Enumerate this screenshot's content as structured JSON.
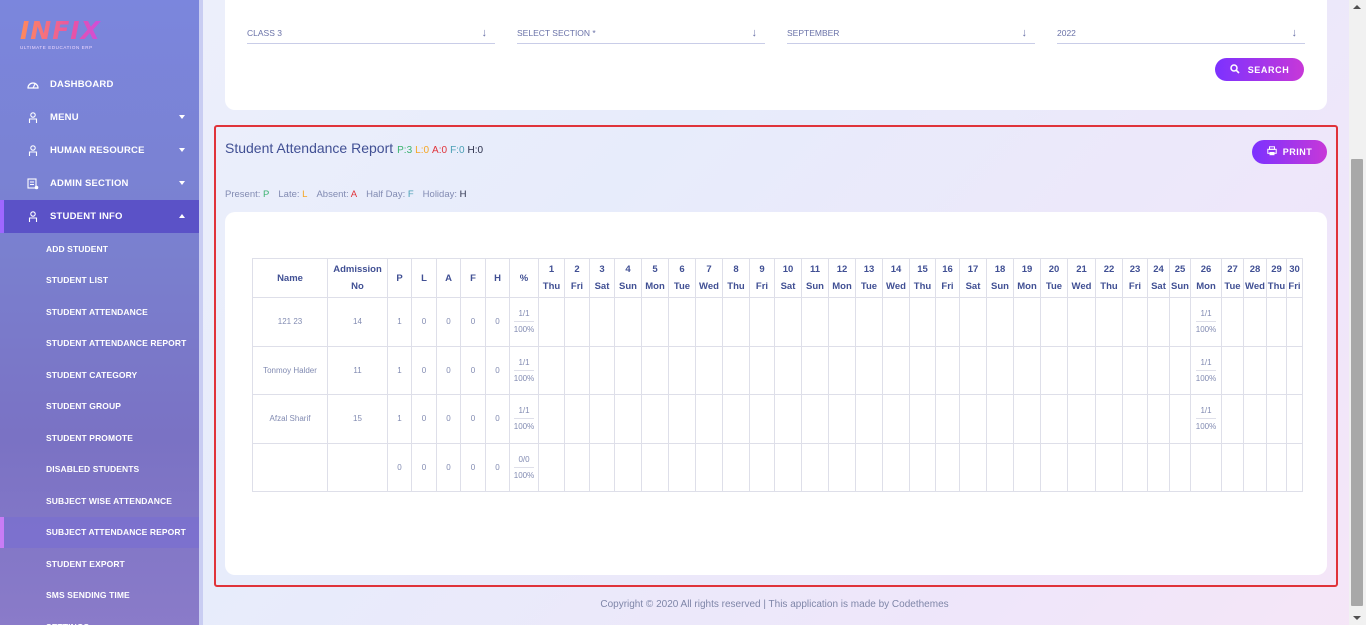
{
  "brand": {
    "logo": "INFIX",
    "tagline": "ULTIMATE EDUCATION ERP"
  },
  "sidebar": {
    "items": [
      {
        "label": "DASHBOARD",
        "icon": "dashboard-icon",
        "has_caret": false
      },
      {
        "label": "MENU",
        "icon": "menu-icon",
        "has_caret": true
      },
      {
        "label": "HUMAN RESOURCE",
        "icon": "hr-icon",
        "has_caret": true
      },
      {
        "label": "ADMIN SECTION",
        "icon": "admin-icon",
        "has_caret": true
      },
      {
        "label": "STUDENT INFO",
        "icon": "student-icon",
        "has_caret": true,
        "active": true
      }
    ],
    "sub_items": [
      "ADD STUDENT",
      "STUDENT LIST",
      "STUDENT ATTENDANCE",
      "STUDENT ATTENDANCE REPORT",
      "STUDENT CATEGORY",
      "STUDENT GROUP",
      "STUDENT PROMOTE",
      "DISABLED STUDENTS",
      "SUBJECT WISE ATTENDANCE",
      "SUBJECT ATTENDANCE REPORT",
      "STUDENT EXPORT",
      "SMS SENDING TIME",
      "SETTINGS"
    ]
  },
  "criteria": {
    "class": "CLASS 3",
    "section": "SELECT SECTION *",
    "month": "SEPTEMBER",
    "year": "2022",
    "search_label": "SEARCH"
  },
  "report": {
    "title": "Student Attendance Report",
    "counts": {
      "p": "P:3",
      "l": "L:0",
      "a": "A:0",
      "f": "F:0",
      "h": "H:0"
    },
    "print_label": "PRINT",
    "legend": {
      "present": "Present:",
      "present_code": "P",
      "late": "Late:",
      "late_code": "L",
      "absent": "Absent:",
      "absent_code": "A",
      "halfday": "Half Day:",
      "halfday_code": "F",
      "holiday": "Holiday:",
      "holiday_code": "H"
    }
  },
  "table": {
    "headers": {
      "name": "Name",
      "admission": "Admission No",
      "p": "P",
      "l": "L",
      "a": "A",
      "f": "F",
      "h": "H",
      "pct": "%"
    },
    "days": [
      {
        "d": "1",
        "w": "Thu"
      },
      {
        "d": "2",
        "w": "Fri"
      },
      {
        "d": "3",
        "w": "Sat"
      },
      {
        "d": "4",
        "w": "Sun"
      },
      {
        "d": "5",
        "w": "Mon"
      },
      {
        "d": "6",
        "w": "Tue"
      },
      {
        "d": "7",
        "w": "Wed"
      },
      {
        "d": "8",
        "w": "Thu"
      },
      {
        "d": "9",
        "w": "Fri"
      },
      {
        "d": "10",
        "w": "Sat"
      },
      {
        "d": "11",
        "w": "Sun"
      },
      {
        "d": "12",
        "w": "Mon"
      },
      {
        "d": "13",
        "w": "Tue"
      },
      {
        "d": "14",
        "w": "Wed"
      },
      {
        "d": "15",
        "w": "Thu"
      },
      {
        "d": "16",
        "w": "Fri"
      },
      {
        "d": "17",
        "w": "Sat"
      },
      {
        "d": "18",
        "w": "Sun"
      },
      {
        "d": "19",
        "w": "Mon"
      },
      {
        "d": "20",
        "w": "Tue"
      },
      {
        "d": "21",
        "w": "Wed"
      },
      {
        "d": "22",
        "w": "Thu"
      },
      {
        "d": "23",
        "w": "Fri"
      },
      {
        "d": "24",
        "w": "Sat"
      },
      {
        "d": "25",
        "w": "Sun"
      },
      {
        "d": "26",
        "w": "Mon"
      },
      {
        "d": "27",
        "w": "Tue"
      },
      {
        "d": "28",
        "w": "Wed"
      },
      {
        "d": "29",
        "w": "Thu"
      },
      {
        "d": "30",
        "w": "Fri"
      }
    ],
    "rows": [
      {
        "name": "121 23",
        "admission": "14",
        "p": "1",
        "l": "0",
        "a": "0",
        "f": "0",
        "h": "0",
        "pct_top": "1/1",
        "pct_bottom": "100%",
        "marks": {
          "26": [
            "1/1",
            "100%"
          ]
        }
      },
      {
        "name": "Tonmoy Halder",
        "admission": "11",
        "p": "1",
        "l": "0",
        "a": "0",
        "f": "0",
        "h": "0",
        "pct_top": "1/1",
        "pct_bottom": "100%",
        "marks": {
          "26": [
            "1/1",
            "100%"
          ]
        }
      },
      {
        "name": "Afzal Sharif",
        "admission": "15",
        "p": "1",
        "l": "0",
        "a": "0",
        "f": "0",
        "h": "0",
        "pct_top": "1/1",
        "pct_bottom": "100%",
        "marks": {
          "26": [
            "1/1",
            "100%"
          ]
        }
      },
      {
        "name": "",
        "admission": "",
        "p": "0",
        "l": "0",
        "a": "0",
        "f": "0",
        "h": "0",
        "pct_top": "0/0",
        "pct_bottom": "100%",
        "marks": {}
      }
    ]
  },
  "footer": "Copyright © 2020 All rights reserved | This application is made by Codethemes",
  "colors": {
    "accent_start": "#7c32ff",
    "accent_end": "#c738d8",
    "highlight_border": "#e0333a"
  }
}
